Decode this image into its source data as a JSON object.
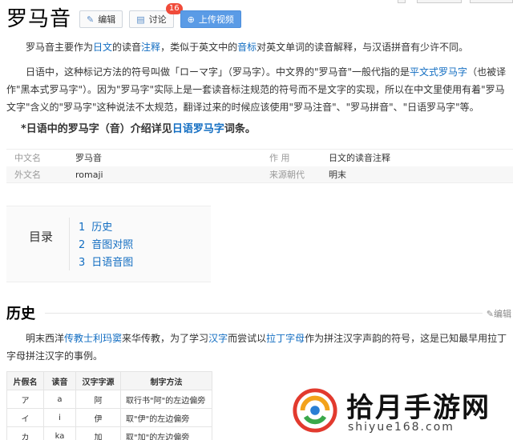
{
  "header": {
    "title": "罗马音",
    "edit_label": "编辑",
    "discuss_label": "讨论",
    "discuss_badge": "16",
    "upload_label": "上传视频"
  },
  "intro": {
    "p1_a": "罗马音主要作为",
    "p1_link1": "日文",
    "p1_b": "的读音",
    "p1_link2": "注释",
    "p1_c": "，类似于英文中的",
    "p1_link3": "音标",
    "p1_d": "对英文单词的读音解释，与汉语拼音有少许不同。",
    "p2_a": "日语中，这种标记方法的符号叫做「ローマ字」（罗马字）。中文界的\"罗马音\"一般代指的是",
    "p2_link1": "平文式罗马字",
    "p2_b": "（也被译作\"黑本式罗马字\"）。因为\"罗马字\"实际上是一套读音标注规范的符号而不是文字的实现，所以在中文里使用有着\"罗马文字\"含义的\"罗马字\"这种说法不太规范，翻译过来的时候应该使用\"罗马注音\"、\"罗马拼音\"、\"日语罗马字\"等。",
    "note_a": "*日语中的罗马字（音）介绍详见",
    "note_link": "日语罗马字",
    "note_b": "词条。"
  },
  "infobox": {
    "rows": [
      {
        "k1": "中文名",
        "v1": "罗马音",
        "k2": "作    用",
        "v2": "日文的读音注释"
      },
      {
        "k1": "外文名",
        "v1": "romaji",
        "k2": "来源朝代",
        "v2": "明末"
      }
    ]
  },
  "toc": {
    "title": "目录",
    "items": [
      {
        "num": "1",
        "label": "历史"
      },
      {
        "num": "2",
        "label": "音图对照"
      },
      {
        "num": "3",
        "label": "日语音图"
      }
    ]
  },
  "history": {
    "heading": "历史",
    "edit_label": "编辑",
    "p_a": "明末西洋",
    "p_link1": "传教士",
    "p_link2": "利玛窦",
    "p_b": "来华传教，为了学习",
    "p_link3": "汉字",
    "p_c": "而尝试以",
    "p_link4": "拉丁字母",
    "p_d": "作为拼注汉字声韵的符号，这是已知最早用拉丁字母拼注汉字的事例。"
  },
  "table": {
    "headers": [
      "片假名",
      "读音",
      "汉字字源",
      "制字方法"
    ],
    "rows": [
      [
        "ア",
        "a",
        "阿",
        "取行书\"阿\"的左边偏旁"
      ],
      [
        "イ",
        "i",
        "伊",
        "取\"伊\"的左边偏旁"
      ],
      [
        "カ",
        "ka",
        "加",
        "取\"加\"的左边偏旁"
      ]
    ]
  },
  "watermark": {
    "text": "拾月手游网",
    "sub": "shiyue168.com"
  },
  "colors": {
    "link": "#136ec2",
    "upload_button": "#5a9be6",
    "badge": "#f04b3a"
  }
}
